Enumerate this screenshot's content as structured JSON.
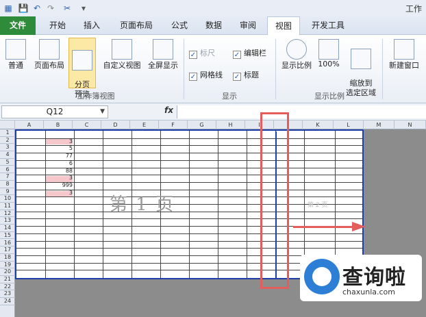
{
  "window": {
    "title": "工作"
  },
  "quick_access": {
    "icons": [
      "save-icon",
      "undo-icon",
      "redo-icon",
      "format-painter-icon",
      "customize-icon"
    ]
  },
  "tabs": [
    {
      "label": "文件"
    },
    {
      "label": "开始"
    },
    {
      "label": "插入"
    },
    {
      "label": "页面布局"
    },
    {
      "label": "公式"
    },
    {
      "label": "数据"
    },
    {
      "label": "审阅"
    },
    {
      "label": "视图",
      "active": true
    },
    {
      "label": "开发工具"
    }
  ],
  "ribbon": {
    "workbook_views": {
      "label": "工作簿视图",
      "normal": "普通",
      "page_layout": "页面布局",
      "page_break_preview": "分页\n预览",
      "custom_views": "自定义视图",
      "full_screen": "全屏显示"
    },
    "show": {
      "label": "显示",
      "ruler": "标尺",
      "formula_bar": "编辑栏",
      "gridlines": "网格线",
      "headings": "标题"
    },
    "zoom": {
      "label": "显示比例",
      "zoom": "显示比例",
      "zoom100": "100%",
      "zoom_selection": "缩放到\n选定区域"
    },
    "window": {
      "new_window": "新建窗口"
    }
  },
  "formula_bar": {
    "name_box": "Q12",
    "fx": "fx",
    "value": ""
  },
  "grid": {
    "columns": [
      "A",
      "B",
      "C",
      "D",
      "E",
      "F",
      "G",
      "H",
      "I",
      "J",
      "K",
      "L",
      "M",
      "N"
    ],
    "rows": [
      "1",
      "2",
      "3",
      "4",
      "5",
      "6",
      "7",
      "8",
      "9",
      "10",
      "11",
      "12",
      "13",
      "14",
      "15",
      "16",
      "17",
      "18",
      "19",
      "20",
      "21",
      "22",
      "23",
      "24"
    ],
    "b_values": [
      "3",
      "5",
      "77",
      "6",
      "88",
      "3",
      "999",
      "3"
    ],
    "page1_label": "第 1 页",
    "page2_label": "第 2 页"
  },
  "watermark": {
    "brand": "查询啦",
    "url": "chaxunla.com"
  },
  "colors": {
    "accent": "#2e8b3a",
    "page_border": "#1f3fa8",
    "highlight": "#e35d5d",
    "pink_cell": "#f6c8cc"
  }
}
